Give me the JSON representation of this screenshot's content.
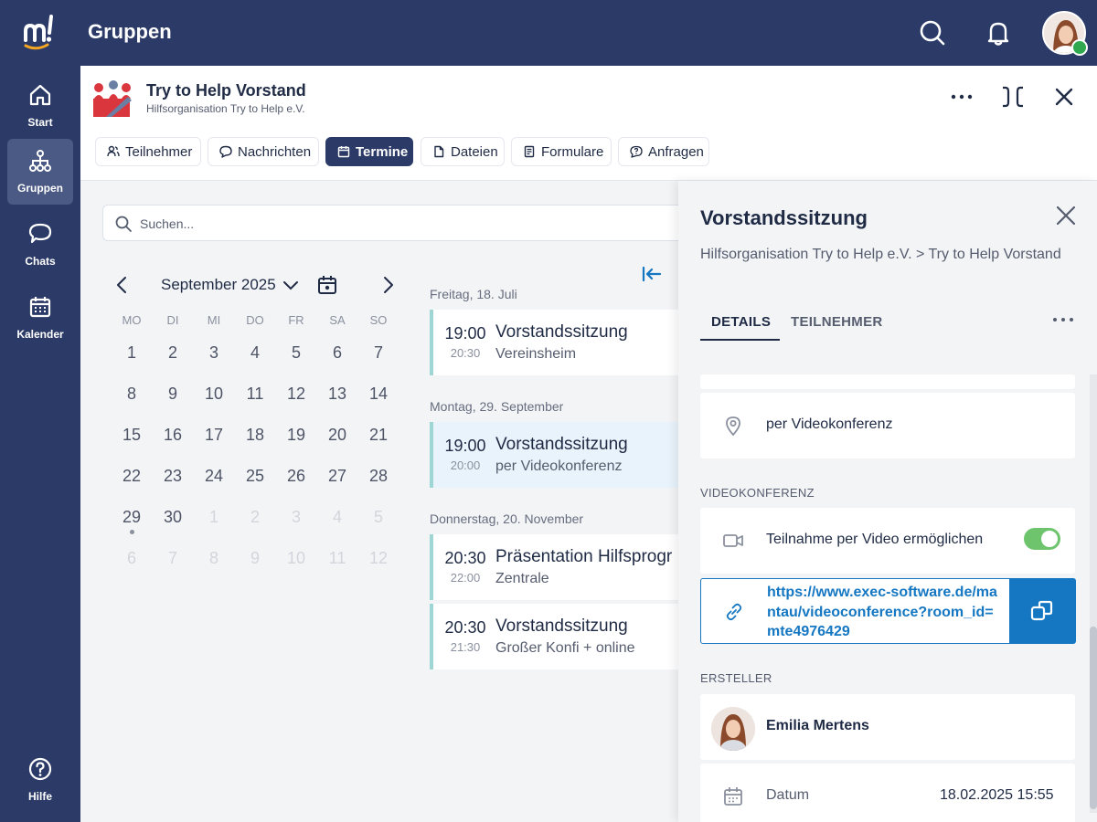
{
  "app": {
    "title": "Gruppen",
    "colors": {
      "navy": "#2b3a67",
      "accent": "#1577c2",
      "online": "#2fa84f",
      "toggle_on": "#6dc46d"
    }
  },
  "topbar": {
    "icons": [
      "search-icon",
      "bell-icon",
      "user-avatar"
    ]
  },
  "sidebar": {
    "items": [
      {
        "label": "Start",
        "icon": "home-icon"
      },
      {
        "label": "Gruppen",
        "icon": "groups-icon",
        "active": true
      },
      {
        "label": "Chats",
        "icon": "chat-icon"
      },
      {
        "label": "Kalender",
        "icon": "calendar-icon"
      },
      {
        "label": "Hilfe",
        "icon": "help-icon"
      }
    ]
  },
  "group": {
    "title": "Try to Help Vorstand",
    "subtitle": "Hilfsorganisation Try to Help e.V.",
    "tabs": [
      {
        "label": "Teilnehmer",
        "icon": "people-icon"
      },
      {
        "label": "Nachrichten",
        "icon": "chat-bubble-icon"
      },
      {
        "label": "Termine",
        "icon": "calendar-icon",
        "active": true
      },
      {
        "label": "Dateien",
        "icon": "file-icon"
      },
      {
        "label": "Formulare",
        "icon": "form-icon"
      },
      {
        "label": "Anfragen",
        "icon": "question-icon"
      }
    ]
  },
  "search": {
    "placeholder": "Suchen..."
  },
  "calendar": {
    "month_label": "September 2025",
    "weekdays": [
      "MO",
      "DI",
      "MI",
      "DO",
      "FR",
      "SA",
      "SO"
    ],
    "weeks": [
      [
        "1",
        "2",
        "3",
        "4",
        "5",
        "6",
        "7"
      ],
      [
        "8",
        "9",
        "10",
        "11",
        "12",
        "13",
        "14"
      ],
      [
        "15",
        "16",
        "17",
        "18",
        "19",
        "20",
        "21"
      ],
      [
        "22",
        "23",
        "24",
        "25",
        "26",
        "27",
        "28"
      ],
      [
        "29",
        "30",
        "1",
        "2",
        "3",
        "4",
        "5"
      ],
      [
        "6",
        "7",
        "8",
        "9",
        "10",
        "11",
        "12"
      ]
    ]
  },
  "events": {
    "groups": [
      {
        "date": "Freitag, 18. Juli",
        "items": [
          {
            "start": "19:00",
            "end": "20:30",
            "title": "Vorstandssitzung",
            "location": "Vereinsheim"
          }
        ]
      },
      {
        "date": "Montag, 29. September",
        "items": [
          {
            "start": "19:00",
            "end": "20:00",
            "title": "Vorstandssitzung",
            "location": "per Videokonferenz",
            "selected": true
          }
        ]
      },
      {
        "date": "Donnerstag, 20. November",
        "items": [
          {
            "start": "20:30",
            "end": "22:00",
            "title": "Präsentation Hilfsprogr",
            "location": "Zentrale"
          },
          {
            "start": "20:30",
            "end": "21:30",
            "title": "Vorstandssitzung",
            "location": "Großer Konfi + online"
          }
        ]
      }
    ]
  },
  "detail": {
    "title": "Vorstandssitzung",
    "breadcrumb": "Hilfsorganisation Try to Help e.V. > Try to Help Vorstand",
    "tabs": [
      "DETAILS",
      "TEILNEHMER"
    ],
    "location": "per Videokonferenz",
    "video_section": "VIDEOKONFERENZ",
    "video_toggle_label": "Teilnahme per Video ermöglichen",
    "video_enabled": true,
    "video_url": "https://www.exec-software.de/mantau/videoconference?room_id=mte4976429",
    "creator_section": "ERSTELLER",
    "creator_name": "Emilia Mertens",
    "date_label": "Datum",
    "date_value": "18.02.2025 15:55"
  }
}
